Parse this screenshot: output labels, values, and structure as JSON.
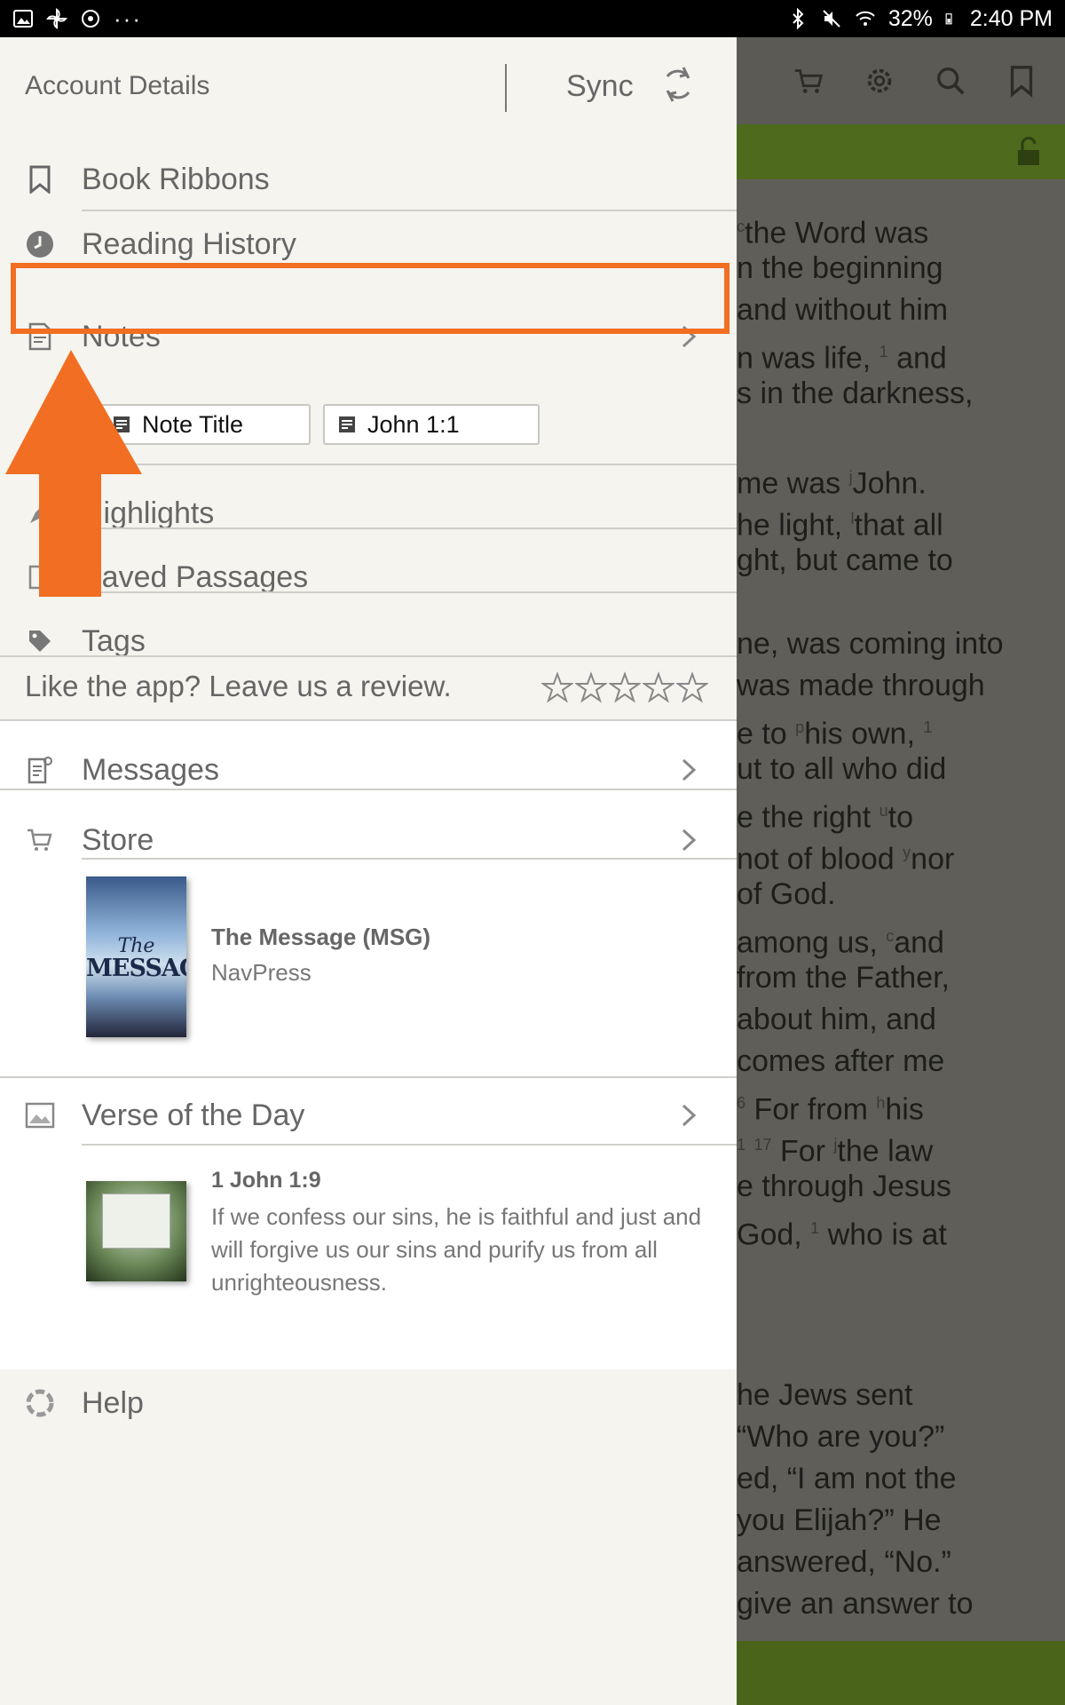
{
  "status_bar": {
    "battery": "32%",
    "time": "2:40 PM"
  },
  "drawer": {
    "account_label": "Account Details",
    "sync_label": "Sync",
    "items": {
      "book_ribbons": "Book Ribbons",
      "reading_history": "Reading History",
      "notes": "Notes",
      "highlights": "Highlights",
      "saved_passages": "Saved Passages",
      "tags": "Tags",
      "messages": "Messages",
      "store": "Store",
      "verse_of_the_day": "Verse of the Day",
      "help": "Help"
    },
    "note_chips": [
      "Note Title",
      "John 1:1"
    ],
    "review_prompt": "Like the app? Leave us a review.",
    "review_stars": 0,
    "store_book": {
      "title": "The Message (MSG)",
      "publisher": "NavPress",
      "cover_line1": "The",
      "cover_line2": "MESSAGE"
    },
    "votd": {
      "reference": "1 John 1:9",
      "text": "If we confess our sins, he is faithful and just and will forgive us our sins and purify us from all unrighteousness."
    }
  },
  "reader": {
    "lines": [
      {
        "sup": "c",
        "text": "the Word was"
      },
      {
        "sup": "",
        "text": "n the beginning"
      },
      {
        "sup": "",
        "text": "and without him"
      },
      {
        "sup": "",
        "text": "n was life, ",
        "sup2": "1",
        "text2": " and"
      },
      {
        "sup": "",
        "text": "s in the darkness,"
      },
      {
        "sup": "",
        "text": ""
      },
      {
        "sup": "",
        "text": "me was ",
        "sup2": "j",
        "text2": "John."
      },
      {
        "sup": "",
        "text": "he light, ",
        "sup2": "l",
        "text2": "that all"
      },
      {
        "sup": "",
        "text": "ght, but came to"
      },
      {
        "sup": "",
        "text": ""
      },
      {
        "sup": "",
        "text": "ne, was coming into"
      },
      {
        "sup": "",
        "text": "was made through"
      },
      {
        "sup": "",
        "text": "e to ",
        "sup2": "p",
        "text2": "his own, ",
        "sup3": "1"
      },
      {
        "sup": "",
        "text": "ut to all who did"
      },
      {
        "sup": "",
        "text": "e the right ",
        "sup2": "u",
        "text2": "to"
      },
      {
        "sup": "",
        "text": "not of blood ",
        "sup2": "y",
        "text2": "nor"
      },
      {
        "sup": "",
        "text": "of God."
      },
      {
        "sup": "",
        "text": " among us, ",
        "sup2": "c",
        "text2": "and"
      },
      {
        "sup": "",
        "text": "from the Father,"
      },
      {
        "sup": "",
        "text": " about him, and"
      },
      {
        "sup": "",
        "text": " comes after me"
      },
      {
        "sup": "6",
        "text": " For from ",
        "sup2": "h",
        "text2": "his"
      },
      {
        "sup": "1",
        "text": " ",
        "sup2": "17",
        "text2": " For ",
        "sup3": "j",
        "text3": "the law"
      },
      {
        "sup": "",
        "text": "e through Jesus"
      },
      {
        "sup": "",
        "text": "God, ",
        "sup2": "1",
        "text2": " who is at"
      },
      {
        "sup": "",
        "text": ""
      },
      {
        "sup": "",
        "text": ""
      },
      {
        "sup": "",
        "text": ""
      },
      {
        "sup": "",
        "text": "he Jews sent"
      },
      {
        "sup": "",
        "text": "“Who are you?”"
      },
      {
        "sup": "",
        "text": "ed, “I am not the"
      },
      {
        "sup": "",
        "text": " you Elijah?” He"
      },
      {
        "sup": "",
        "text": "answered, “No.”"
      },
      {
        "sup": "",
        "text": " give an answer to"
      }
    ]
  },
  "colors": {
    "accent": "#f26e22",
    "reader_green": "#4d6a1d"
  }
}
